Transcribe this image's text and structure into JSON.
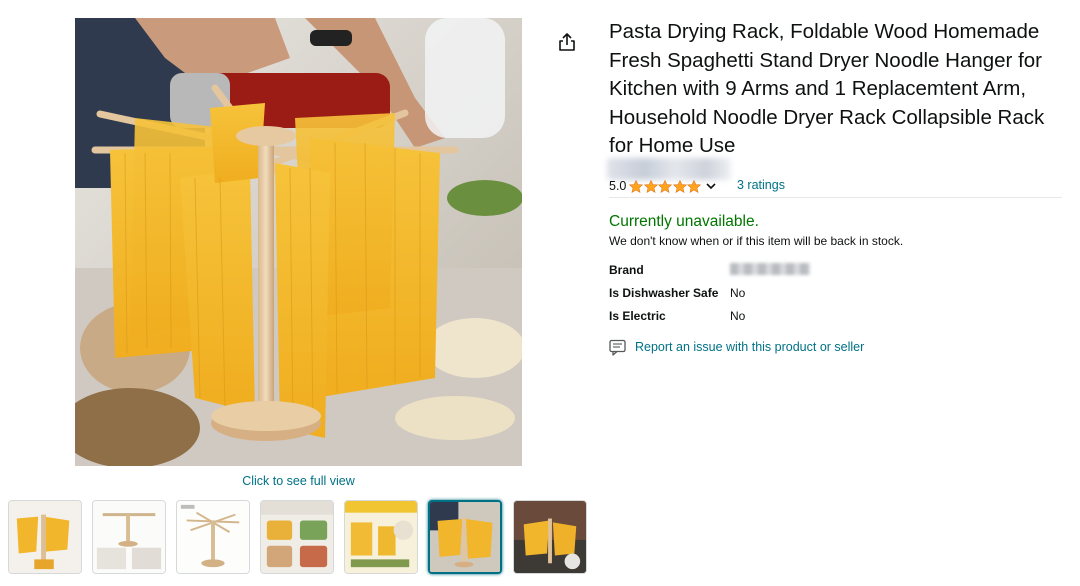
{
  "product": {
    "title": "Pasta Drying Rack, Foldable Wood Homemade Fresh Spaghetti Stand Dryer Noodle Hanger for Kitchen with 9 Arms and 1 Replacemtent Arm, Household Noodle Dryer Rack Collapsible Rack for Home Use",
    "rating_value": "5.0",
    "stars": 5,
    "ratings_text": "3 ratings"
  },
  "gallery": {
    "click_full_view": "Click to see full view",
    "thumbnail_count": 7,
    "selected_index": 5
  },
  "availability": {
    "status": "Currently unavailable.",
    "note": "We don't know when or if this item will be back in stock."
  },
  "attributes": [
    {
      "label": "Brand",
      "value": ""
    },
    {
      "label": "Is Dishwasher Safe",
      "value": "No"
    },
    {
      "label": "Is Electric",
      "value": "No"
    }
  ],
  "report": {
    "label": "Report an issue with this product or seller"
  },
  "icons": {
    "share": "share-icon",
    "star": "star-icon",
    "chevron": "chevron-down-icon",
    "report": "report-message-icon"
  },
  "colors": {
    "link": "#007185",
    "available_green": "#007600",
    "star": "#ffa41c",
    "text": "#0f1111"
  }
}
